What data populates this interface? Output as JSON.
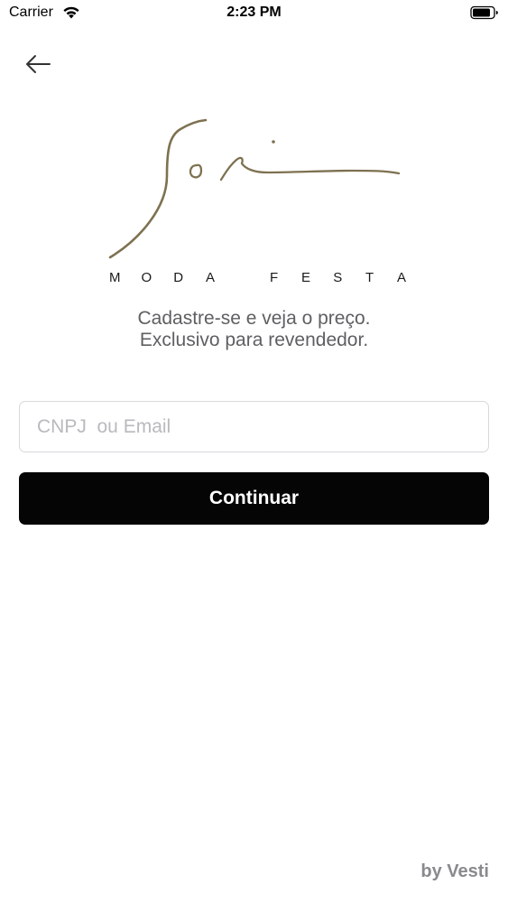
{
  "status_bar": {
    "carrier": "Carrier",
    "time": "2:23 PM",
    "wifi_icon": "wifi-icon",
    "battery_icon": "battery-icon"
  },
  "nav": {
    "back_icon": "arrow-left-icon"
  },
  "logo": {
    "subtitle_letters": [
      "M",
      "O",
      "D",
      "A",
      "",
      "F",
      "E",
      "S",
      "T",
      "A"
    ],
    "accent_color": "#7d7150"
  },
  "tagline": {
    "line1": "Cadastre-se e veja o preço.",
    "line2": "Exclusivo para revendedor."
  },
  "form": {
    "input_placeholder": "CNPJ  ou Email",
    "input_value": "",
    "continue_label": "Continuar"
  },
  "footer": {
    "text": "by Vesti"
  },
  "colors": {
    "button_bg": "#050505",
    "button_text": "#ffffff",
    "tagline": "#5f5f62",
    "placeholder": "#b9b9be",
    "footer": "#8a8a8e"
  }
}
